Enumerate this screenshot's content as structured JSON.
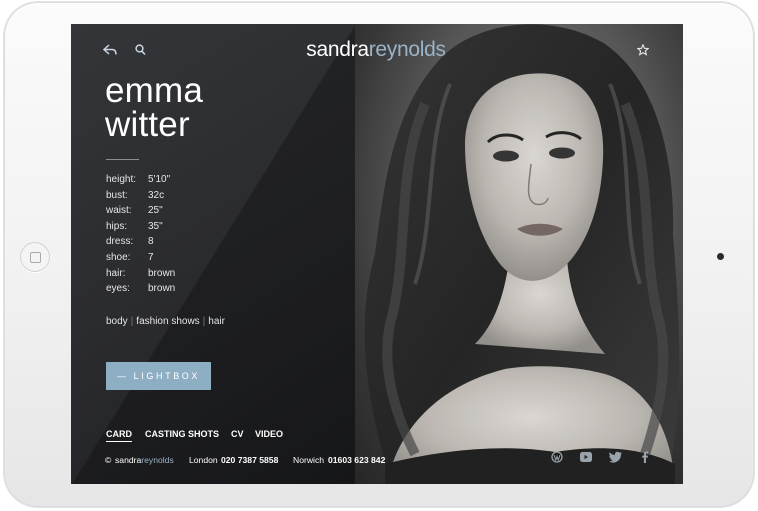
{
  "brand": {
    "part1": "sandra",
    "part2": "reynolds"
  },
  "model": {
    "first_name": "emma",
    "last_name": "witter"
  },
  "stats": [
    {
      "label": "height:",
      "value": "5'10\""
    },
    {
      "label": "bust:",
      "value": "32c"
    },
    {
      "label": "waist:",
      "value": "25\""
    },
    {
      "label": "hips:",
      "value": "35\""
    },
    {
      "label": "dress:",
      "value": "8"
    },
    {
      "label": "shoe:",
      "value": "7"
    },
    {
      "label": "hair:",
      "value": "brown"
    },
    {
      "label": "eyes:",
      "value": "brown"
    }
  ],
  "categories": [
    "body",
    "fashion shows",
    "hair"
  ],
  "lightbox_label": "— LIGHTBOX",
  "tabs": [
    "CARD",
    "CASTING SHOTS",
    "CV",
    "VIDEO"
  ],
  "footer": {
    "copyright_symbol": "©",
    "brand_part1": "sandra",
    "brand_part2": "reynolds",
    "london_label": "London",
    "london_phone": "020 7387 5858",
    "norwich_label": "Norwich",
    "norwich_phone": "01603 623 842"
  },
  "icons": {
    "back": "back-arrow-icon",
    "search": "search-icon",
    "favourite": "star-icon",
    "social": [
      "wordpress-icon",
      "youtube-icon",
      "twitter-icon",
      "facebook-icon"
    ]
  },
  "colors": {
    "accent": "#8eaec4",
    "brand_light": "#9ab3c6",
    "panel_dark": "#2b2c30"
  }
}
